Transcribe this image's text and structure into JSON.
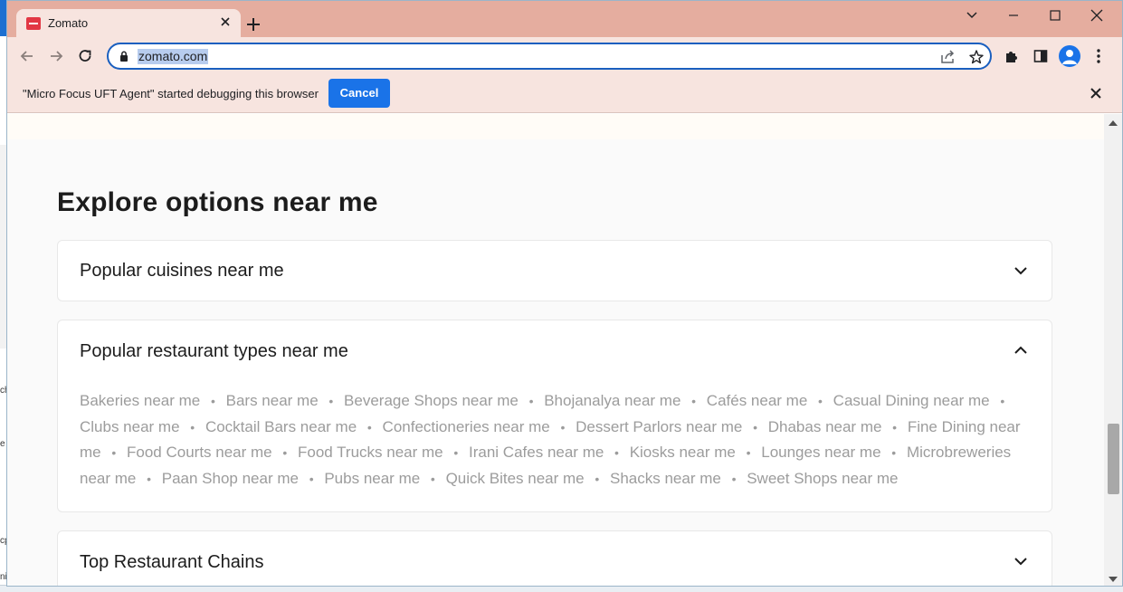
{
  "browser": {
    "tab_title": "Zomato",
    "url": "zomato.com"
  },
  "infobar": {
    "message": "\"Micro Focus UFT Agent\" started debugging this browser",
    "cancel_label": "Cancel"
  },
  "page": {
    "heading": "Explore options near me",
    "sections": [
      {
        "title": "Popular cuisines near me",
        "expanded": false
      },
      {
        "title": "Popular restaurant types near me",
        "expanded": true,
        "items": [
          "Bakeries near me",
          "Bars near me",
          "Beverage Shops near me",
          "Bhojanalya near me",
          "Cafés near me",
          "Casual Dining near me",
          "Clubs near me",
          "Cocktail Bars near me",
          "Confectioneries near me",
          "Dessert Parlors near me",
          "Dhabas near me",
          "Fine Dining near me",
          "Food Courts near me",
          "Food Trucks near me",
          "Irani Cafes near me",
          "Kiosks near me",
          "Lounges near me",
          "Microbreweries near me",
          "Paan Shop near me",
          "Pubs near me",
          "Quick Bites near me",
          "Shacks near me",
          "Sweet Shops near me"
        ]
      },
      {
        "title": "Top Restaurant Chains",
        "expanded": false
      }
    ]
  },
  "desktop_fragments": [
    "ch",
    "e",
    "cp",
    "ni"
  ],
  "colors": {
    "titlebar": "#e5ad9f",
    "toolbar": "#f7e4df",
    "accent": "#1a73e8",
    "zomato_red": "#e23744"
  }
}
